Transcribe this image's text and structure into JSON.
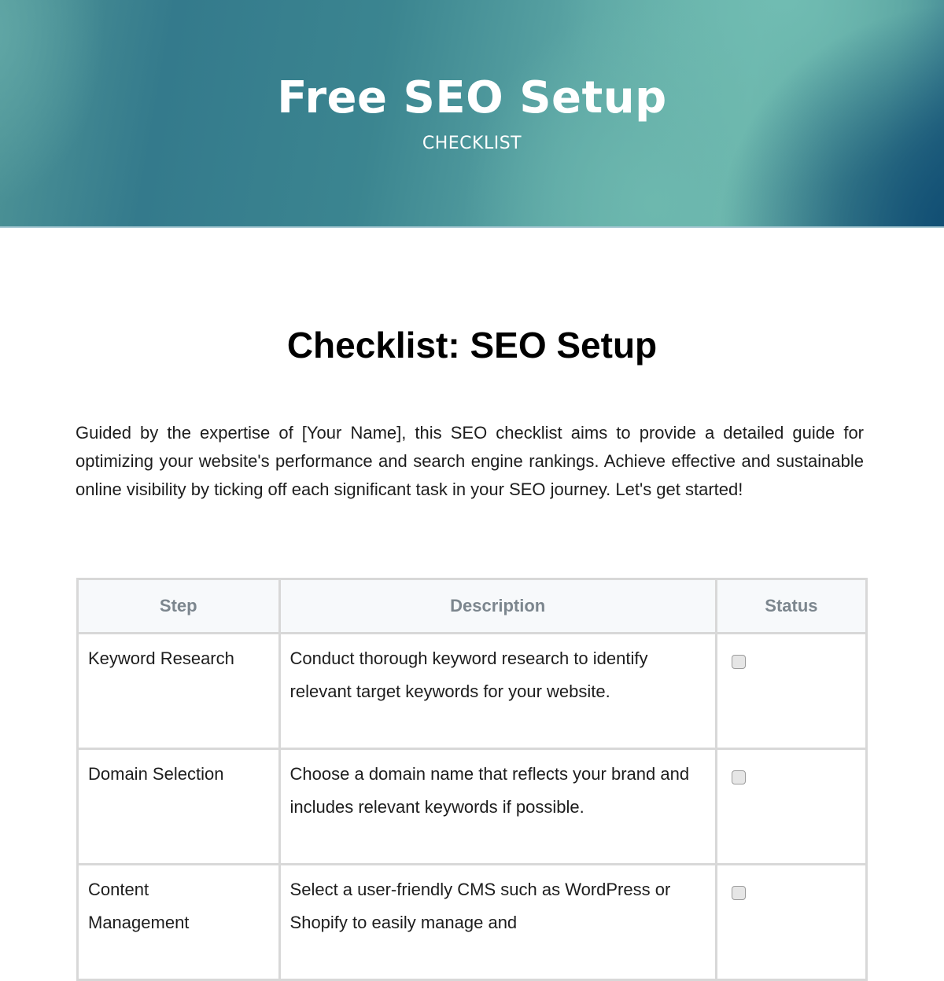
{
  "banner": {
    "title": "Free SEO Setup",
    "subtitle": "CHECKLIST",
    "colors": {
      "teal_dark": "#347a8c",
      "teal_light": "#6cb6ac",
      "navy": "#0f4c72"
    }
  },
  "document": {
    "title": "Checklist: SEO Setup",
    "intro": "Guided by the expertise of [Your Name], this SEO checklist aims to provide a detailed guide for optimizing your website's performance and search engine rankings. Achieve effective and sustainable online visibility by ticking off each significant task in your SEO journey. Let's get started!"
  },
  "table": {
    "headers": [
      "Step",
      "Description",
      "Status"
    ],
    "rows": [
      {
        "step": "Keyword Research",
        "description": "Conduct thorough keyword research to identify relevant target keywords for your website.",
        "checked": false
      },
      {
        "step": "Domain Selection",
        "description": "Choose a domain name that reflects your brand and includes relevant keywords if possible.",
        "checked": false
      },
      {
        "step": "Content Management",
        "description": "Select a user-friendly CMS such as WordPress or Shopify to easily manage and",
        "checked": false
      }
    ]
  }
}
